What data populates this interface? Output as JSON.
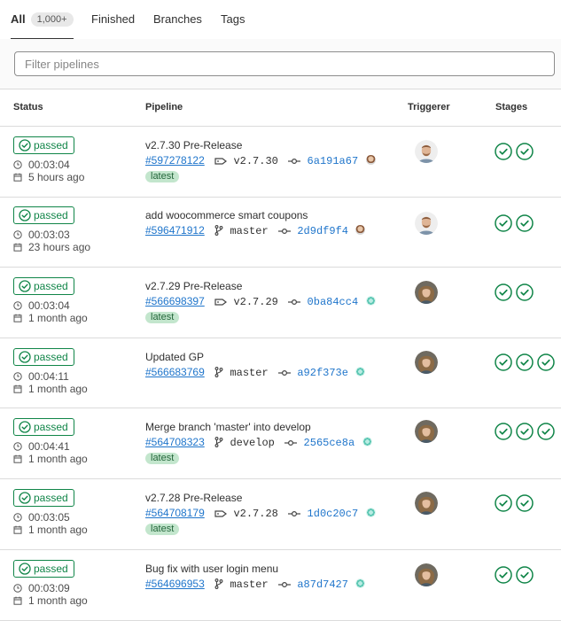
{
  "tabs": [
    {
      "label": "All",
      "count": "1,000+"
    },
    {
      "label": "Finished"
    },
    {
      "label": "Branches"
    },
    {
      "label": "Tags"
    }
  ],
  "filter": {
    "placeholder": "Filter pipelines",
    "value": ""
  },
  "columns": {
    "status": "Status",
    "pipeline": "Pipeline",
    "triggerer": "Triggerer",
    "stages": "Stages"
  },
  "colors": {
    "success": "#108548",
    "link": "#1f75cb",
    "latest_bg": "#c3e6cd"
  },
  "rows": [
    {
      "status": "passed",
      "duration": "00:03:04",
      "finished": "5 hours ago",
      "title": "v2.7.30 Pre-Release",
      "id": "#597278122",
      "ref_type": "tag",
      "ref": "v2.7.30",
      "sha": "6a191a67",
      "commit_avatar": "face",
      "latest": "latest",
      "triggerer": "man",
      "stages": 2
    },
    {
      "status": "passed",
      "duration": "00:03:03",
      "finished": "23 hours ago",
      "title": "add woocommerce smart coupons",
      "id": "#596471912",
      "ref_type": "branch",
      "ref": "master",
      "sha": "2d9df9f4",
      "commit_avatar": "face",
      "latest": "",
      "triggerer": "man",
      "stages": 2
    },
    {
      "status": "passed",
      "duration": "00:03:04",
      "finished": "1 month ago",
      "title": "v2.7.29 Pre-Release",
      "id": "#566698397",
      "ref_type": "tag",
      "ref": "v2.7.29",
      "sha": "0ba84cc4",
      "commit_avatar": "gear",
      "latest": "latest",
      "triggerer": "woman",
      "stages": 2
    },
    {
      "status": "passed",
      "duration": "00:04:11",
      "finished": "1 month ago",
      "title": "Updated GP",
      "id": "#566683769",
      "ref_type": "branch",
      "ref": "master",
      "sha": "a92f373e",
      "commit_avatar": "gear",
      "latest": "",
      "triggerer": "woman",
      "stages": 3
    },
    {
      "status": "passed",
      "duration": "00:04:41",
      "finished": "1 month ago",
      "title": "Merge branch 'master' into develop",
      "id": "#564708323",
      "ref_type": "branch",
      "ref": "develop",
      "sha": "2565ce8a",
      "commit_avatar": "gear",
      "latest": "latest",
      "triggerer": "woman",
      "stages": 3
    },
    {
      "status": "passed",
      "duration": "00:03:05",
      "finished": "1 month ago",
      "title": "v2.7.28 Pre-Release",
      "id": "#564708179",
      "ref_type": "tag",
      "ref": "v2.7.28",
      "sha": "1d0c20c7",
      "commit_avatar": "gear",
      "latest": "latest",
      "triggerer": "woman",
      "stages": 2
    },
    {
      "status": "passed",
      "duration": "00:03:09",
      "finished": "1 month ago",
      "title": "Bug fix with user login menu",
      "id": "#564696953",
      "ref_type": "branch",
      "ref": "master",
      "sha": "a87d7427",
      "commit_avatar": "gear",
      "latest": "",
      "triggerer": "woman",
      "stages": 2
    }
  ]
}
